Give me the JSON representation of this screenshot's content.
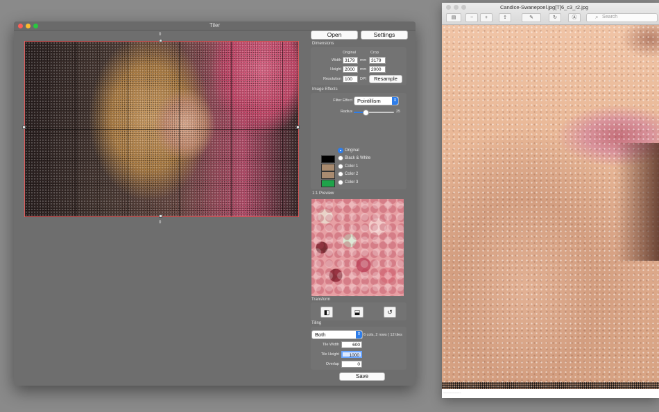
{
  "tiler_window": {
    "title": "Tiler",
    "ruler_top": "0",
    "ruler_bottom": "0",
    "buttons": {
      "open": "Open",
      "settings": "Settings",
      "save": "Save"
    },
    "dimensions": {
      "section": "Dimensions",
      "col_original": "Original",
      "col_crop": "Crop",
      "width_label": "Width",
      "height_label": "Height",
      "resolution_label": "Resolution",
      "width_original": "3179",
      "width_crop": "3179",
      "height_original": "2000",
      "height_crop": "2000",
      "unit_mm": "mm",
      "resolution": "100",
      "unit_dpi": "DPI",
      "resample": "Resample"
    },
    "image_effects": {
      "section": "Image Effects",
      "filter_label": "Filter Effect",
      "filter_value": "Pointillism",
      "radius_label": "Radius",
      "radius_value": "25",
      "radius_fraction": 0.3,
      "color_options": [
        {
          "label": "Original",
          "selected": true
        },
        {
          "label": "Black & White",
          "selected": false
        },
        {
          "label": "Color 1",
          "selected": false
        },
        {
          "label": "Color 2",
          "selected": false
        },
        {
          "label": "Color 3",
          "selected": false
        }
      ],
      "swatch_colors": [
        "#000000",
        "#a88a6e",
        "#a98b70",
        "#1fa34a"
      ]
    },
    "preview": {
      "section": "1:1 Preview"
    },
    "transform": {
      "section": "Transform"
    },
    "tiling": {
      "section": "Tiling",
      "mode": "Both",
      "summary": "6 cols, 2 rows ( 12 tiles",
      "tile_width_label": "Tile Width",
      "tile_width": "600",
      "tile_height_label": "Tile Height",
      "tile_height": "1000",
      "overlap_label": "Overlap",
      "overlap": "0"
    }
  },
  "preview_window": {
    "title": "Candice-Swanepoel.jpg[T]6_c3_r2.jpg",
    "search_placeholder": "Search",
    "footer_text": "~~~~~~~~~~~"
  },
  "colors": {
    "accent": "#2e7de9",
    "crop_border": "#e05a5a",
    "window_bg": "#6e6e6e"
  }
}
